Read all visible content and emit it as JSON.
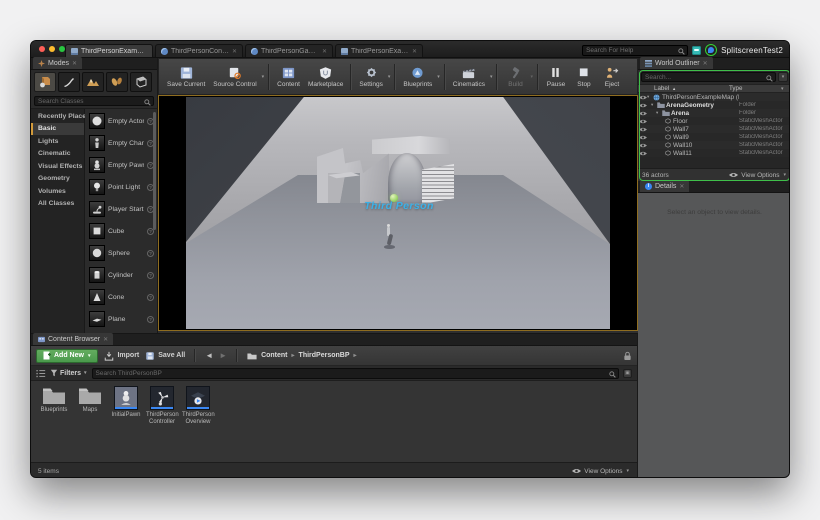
{
  "titlebar": {
    "window_title": "SplitscreenTest2",
    "help_placeholder": "Search For Help",
    "tabs": [
      {
        "label": "ThirdPersonExampleMap"
      },
      {
        "label": "ThirdPersonController"
      },
      {
        "label": "ThirdPersonGameMode"
      },
      {
        "label": "ThirdPersonExampleMap"
      }
    ]
  },
  "toolbar": {
    "items": [
      {
        "label": "Save Current"
      },
      {
        "label": "Source Control"
      },
      {
        "label": "Content"
      },
      {
        "label": "Marketplace"
      },
      {
        "label": "Settings"
      },
      {
        "label": "Blueprints"
      },
      {
        "label": "Cinematics"
      },
      {
        "label": "Build"
      },
      {
        "label": "Pause"
      },
      {
        "label": "Stop"
      },
      {
        "label": "Eject"
      }
    ]
  },
  "modes": {
    "tab_label": "Modes",
    "search_placeholder": "Search Classes",
    "categories": [
      "Recently Placed",
      "Basic",
      "Lights",
      "Cinematic",
      "Visual Effects",
      "Geometry",
      "Volumes",
      "All Classes"
    ],
    "selected_category": "Basic",
    "items": [
      "Empty Actor",
      "Empty Character",
      "Empty Pawn",
      "Point Light",
      "Player Start",
      "Cube",
      "Sphere",
      "Cylinder",
      "Cone",
      "Plane"
    ]
  },
  "viewport": {
    "overlay_text": "Third Person"
  },
  "outliner": {
    "tab_label": "World Outliner",
    "search_placeholder": "Search...",
    "columns": {
      "label": "Label",
      "type": "Type"
    },
    "rows": [
      {
        "label": "ThirdPersonExampleMap (PlayWorld)",
        "type": ""
      },
      {
        "label": "ArenaGeometry",
        "type": "Folder"
      },
      {
        "label": "Arena",
        "type": "Folder"
      },
      {
        "label": "Floor",
        "type": "StaticMeshActor"
      },
      {
        "label": "Wall7",
        "type": "StaticMeshActor"
      },
      {
        "label": "Wall9",
        "type": "StaticMeshActor"
      },
      {
        "label": "Wall10",
        "type": "StaticMeshActor"
      },
      {
        "label": "Wall11",
        "type": "StaticMeshActor"
      }
    ],
    "footer": {
      "count": "36 actors",
      "view_options": "View Options"
    }
  },
  "details": {
    "tab_label": "Details",
    "empty_text": "Select an object to view details."
  },
  "content_browser": {
    "tab_label": "Content Browser",
    "add_new": "Add New",
    "import": "Import",
    "save_all": "Save All",
    "path": [
      "Content",
      "ThirdPersonBP"
    ],
    "filters": "Filters",
    "search_placeholder": "Search ThirdPersonBP",
    "assets": [
      {
        "name": "Blueprints",
        "kind": "folder"
      },
      {
        "name": "Maps",
        "kind": "folder"
      },
      {
        "name": "InitialPawn",
        "kind": "asset"
      },
      {
        "name": "ThirdPerson Controller",
        "kind": "asset"
      },
      {
        "name": "ThirdPerson Overview",
        "kind": "asset"
      }
    ],
    "footer": {
      "count": "5 items",
      "view_options": "View Options"
    }
  },
  "colors": {
    "accent-blue": "#3bb1e8",
    "highlight-green": "#3fbf4a",
    "viewport-border-yellow": "#8f6d20",
    "add-button-green": "#4a9a4c",
    "asset-bar-blue": "#3a87f2",
    "traffic-red": "#ff5f57",
    "traffic-yellow": "#febc2e",
    "traffic-green": "#28c840"
  }
}
